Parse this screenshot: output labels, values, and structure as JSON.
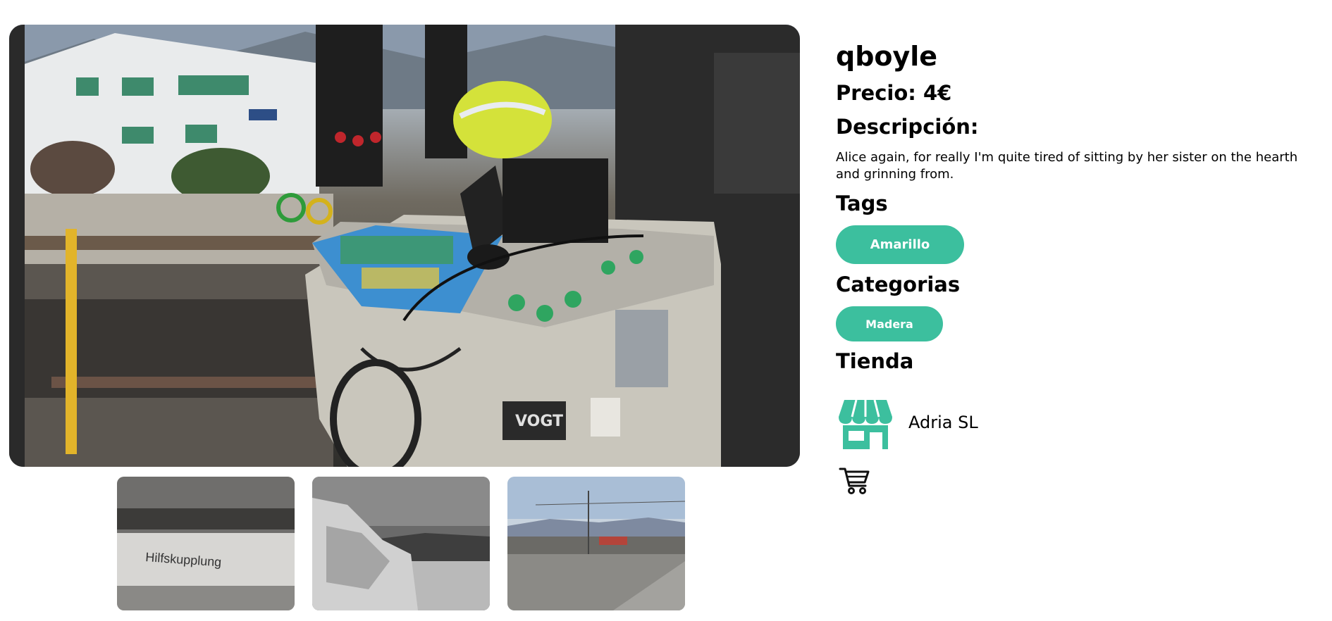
{
  "product": {
    "name": "qboyle",
    "price_label": "Precio: 4€",
    "description_heading": "Descripción:",
    "description": "Alice again, for really I'm quite tired of sitting by her sister on the hearth and grinning from.",
    "tags_heading": "Tags",
    "tags": [
      "Amarillo"
    ],
    "categories_heading": "Categorias",
    "categories": [
      "Madera"
    ],
    "store_heading": "Tienda",
    "store": {
      "name": "Adria SL",
      "icon": "store-icon"
    },
    "cart": {
      "icon": "cart-icon"
    }
  },
  "gallery": {
    "main_image": "train-cab-control-desk",
    "thumbnails": [
      "train-seat-hilfskupplung",
      "rocky-beach-bw",
      "railway-station-platform"
    ]
  },
  "colors": {
    "accent": "#3cbf9e",
    "text": "#000000",
    "background": "#ffffff"
  }
}
